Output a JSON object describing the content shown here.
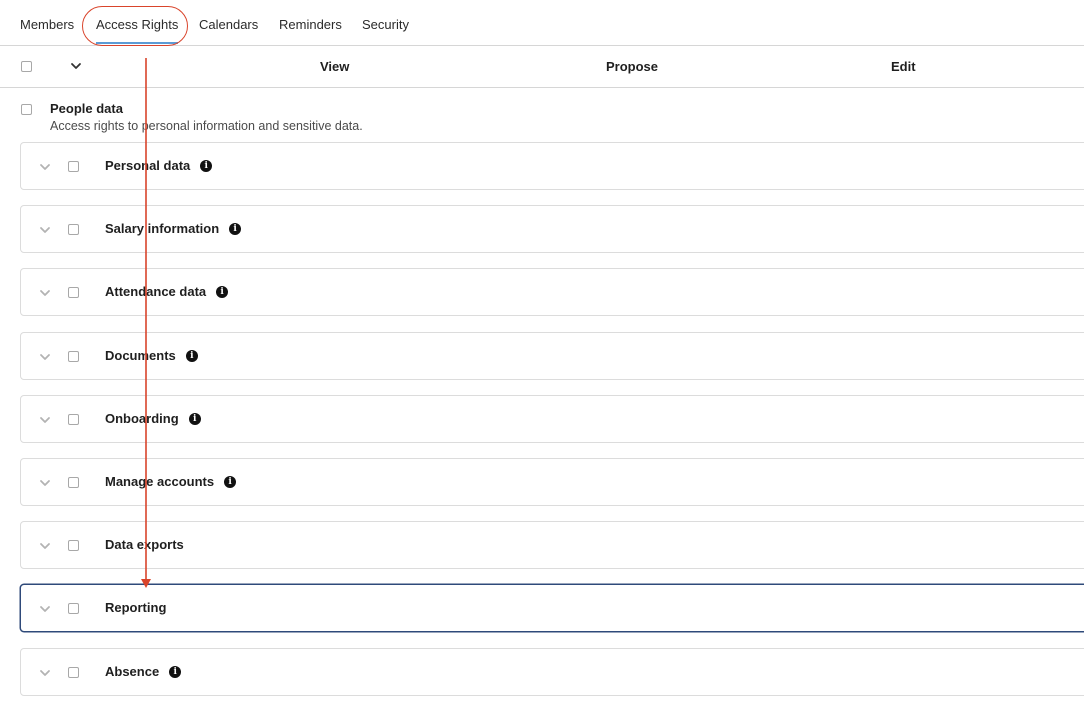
{
  "tabs": [
    {
      "label": "Members"
    },
    {
      "label": "Access Rights"
    },
    {
      "label": "Calendars"
    },
    {
      "label": "Reminders"
    },
    {
      "label": "Security"
    }
  ],
  "active_tab": "Access Rights",
  "columns": {
    "view": "View",
    "propose": "Propose",
    "edit": "Edit"
  },
  "section": {
    "title": "People data",
    "description": "Access rights to personal information and sensitive data."
  },
  "rows": [
    {
      "label": "Personal data",
      "has_info": true
    },
    {
      "label": "Salary information",
      "has_info": true
    },
    {
      "label": "Attendance data",
      "has_info": true
    },
    {
      "label": "Documents",
      "has_info": true
    },
    {
      "label": "Onboarding",
      "has_info": true
    },
    {
      "label": "Manage accounts",
      "has_info": true
    },
    {
      "label": "Data exports",
      "has_info": false
    },
    {
      "label": "Reporting",
      "has_info": false,
      "focused": true
    },
    {
      "label": "Absence",
      "has_info": true
    }
  ],
  "icons": {
    "info": "info-icon",
    "chevron": "chevron-down-icon",
    "info_glyph": "i"
  },
  "colors": {
    "annotation": "#d9442b",
    "active_tab_underline": "#5b9bd5",
    "focus_border": "#2f4a7a"
  }
}
